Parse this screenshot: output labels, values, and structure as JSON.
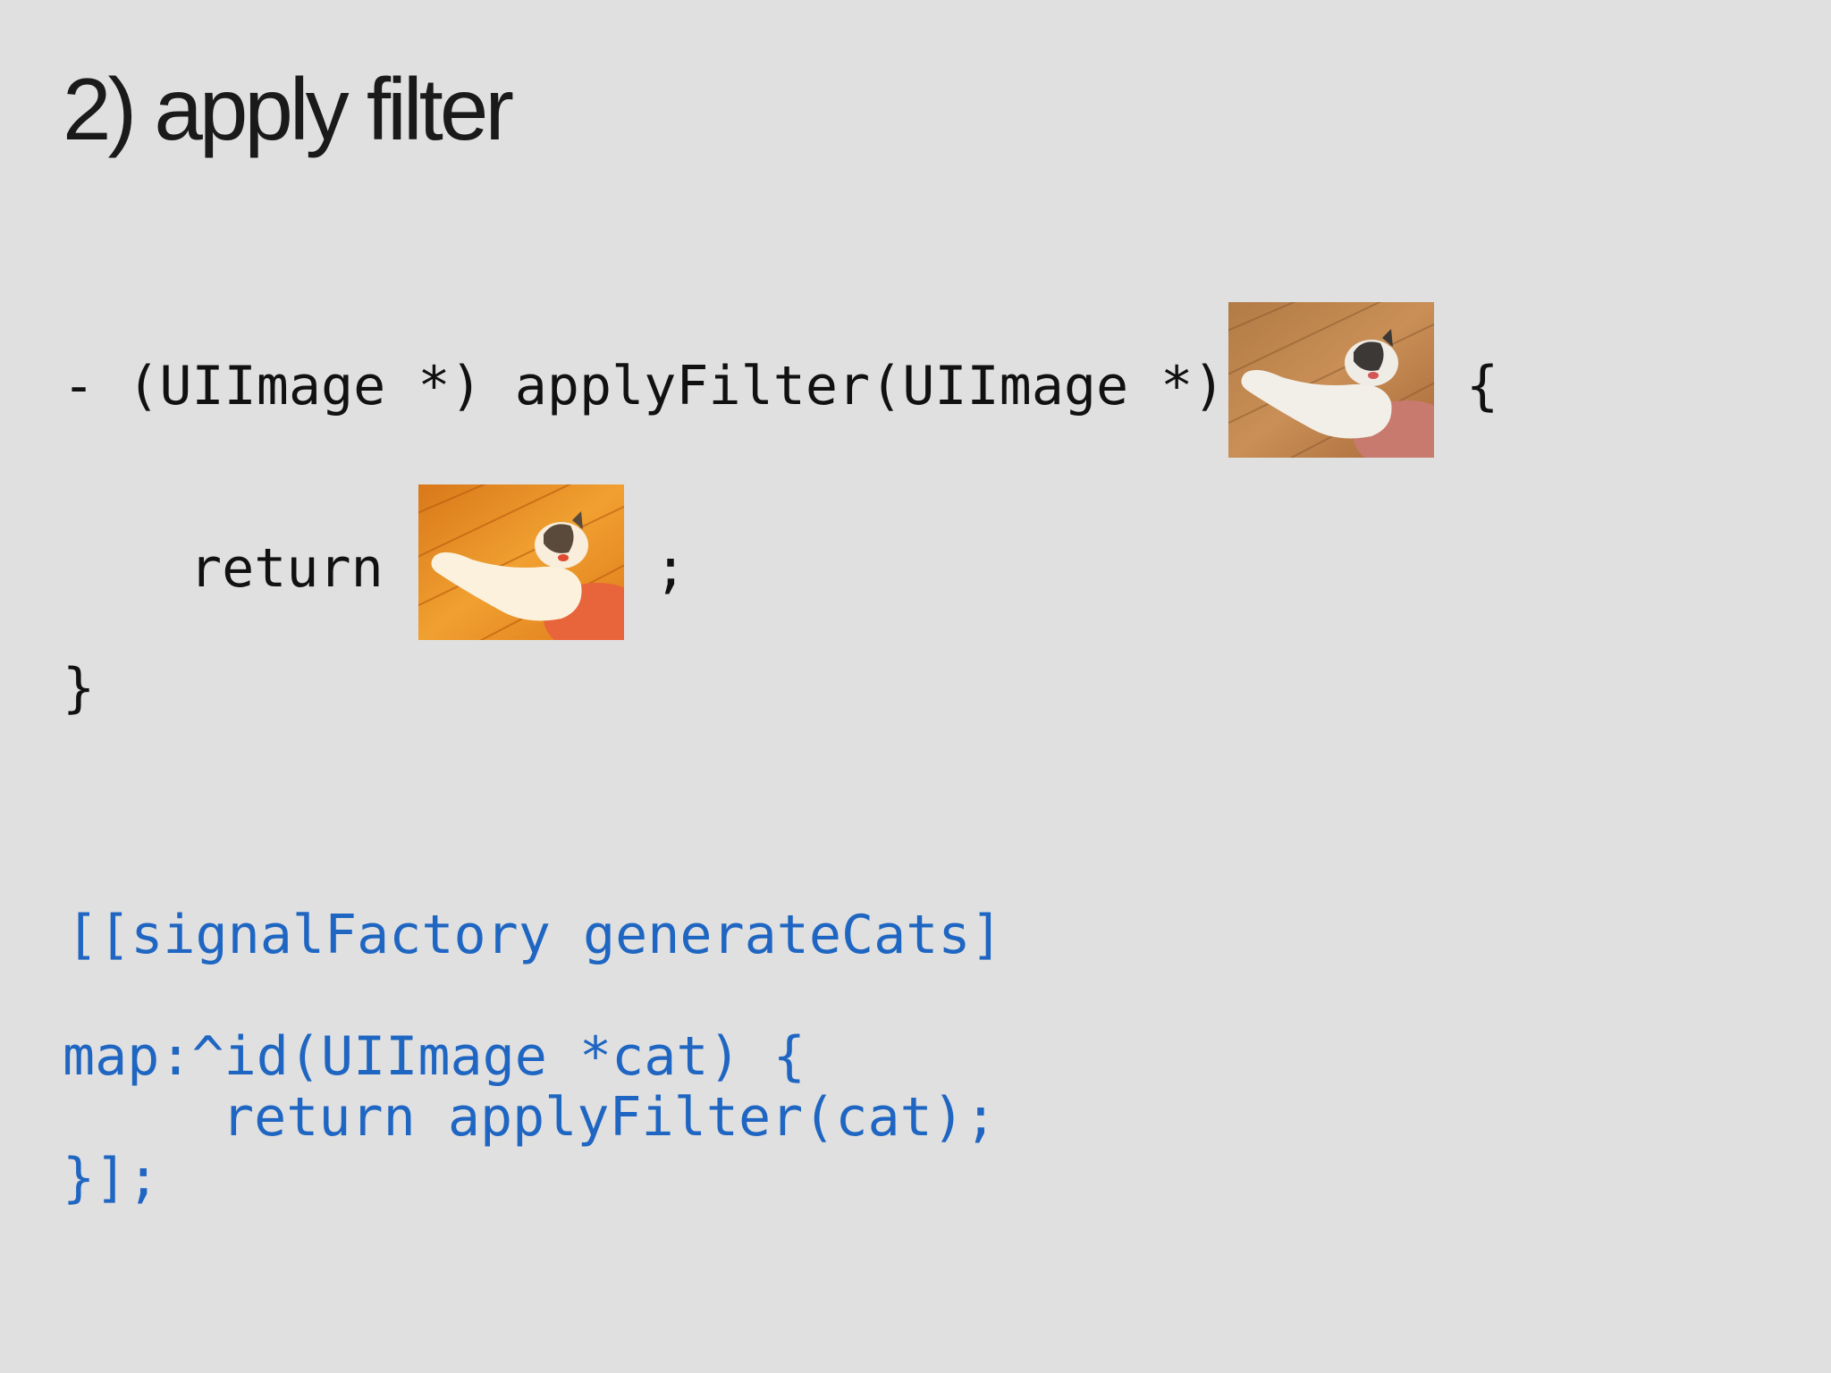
{
  "slide": {
    "title": "2) apply filter"
  },
  "code_top": {
    "line1_prefix": "- (UIImage *) applyFilter(UIImage *)",
    "line1_suffix": "{",
    "line2_prefix": "return",
    "line2_suffix": ";",
    "line3": "}"
  },
  "images": {
    "input_cat": "photo of a white and gray cat on a wooden floor (original)",
    "output_cat": "photo of the same cat with an orange filter applied"
  },
  "code_bottom": {
    "line1": "[[signalFactory generateCats]",
    "line2": "map:^id(UIImage *cat) {",
    "line3": "return applyFilter(cat);",
    "line4": "}];"
  },
  "colors": {
    "background": "#e0e0e0",
    "text": "#111111",
    "code_blue": "#1f66c2"
  }
}
